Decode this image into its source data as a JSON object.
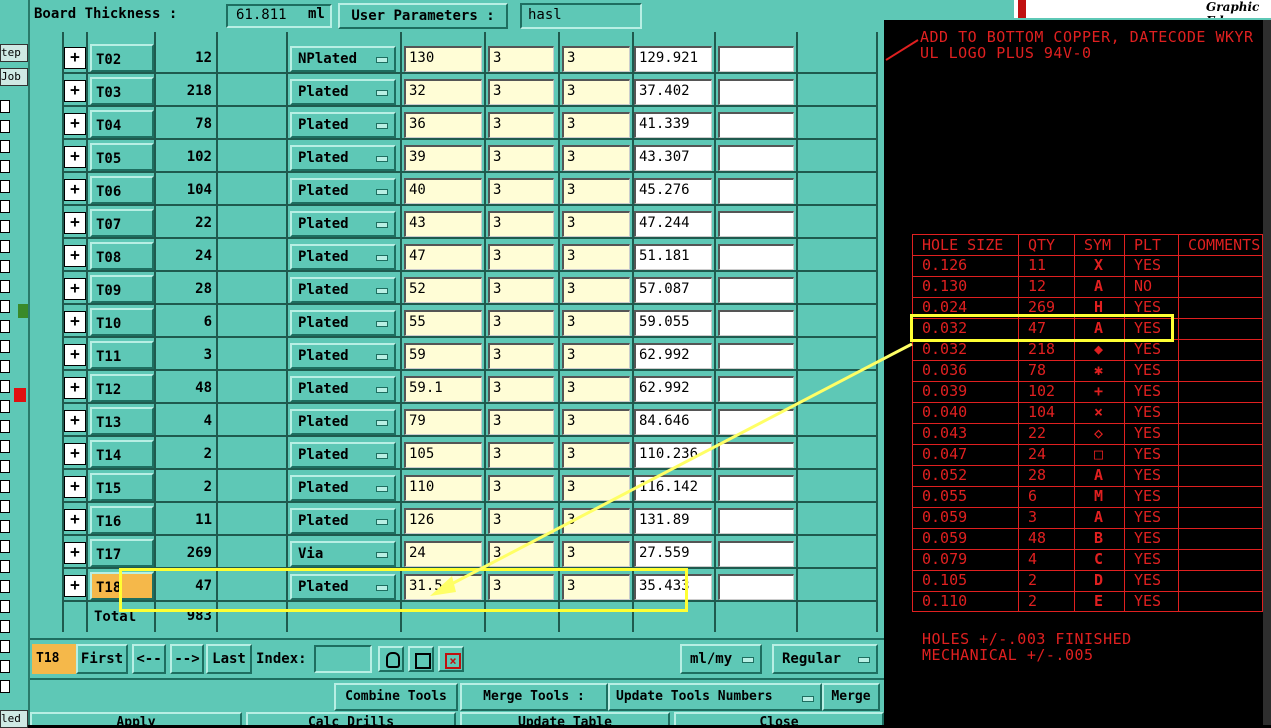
{
  "header": {
    "board_thickness_label": "Board Thickness :",
    "board_thickness_value": "61.811",
    "board_thickness_unit": "ml",
    "user_params_label": "User Parameters :",
    "user_params_value": "hasl"
  },
  "leftstrip": {
    "step_label": "tep",
    "job_label": "Job",
    "bottom_label": "led"
  },
  "tools": [
    {
      "id": "T02",
      "qty": "12",
      "type": "NPlated",
      "size": "130",
      "a": "3",
      "b": "3",
      "fin": "129.921"
    },
    {
      "id": "T03",
      "qty": "218",
      "type": "Plated",
      "size": "32",
      "a": "3",
      "b": "3",
      "fin": "37.402"
    },
    {
      "id": "T04",
      "qty": "78",
      "type": "Plated",
      "size": "36",
      "a": "3",
      "b": "3",
      "fin": "41.339"
    },
    {
      "id": "T05",
      "qty": "102",
      "type": "Plated",
      "size": "39",
      "a": "3",
      "b": "3",
      "fin": "43.307"
    },
    {
      "id": "T06",
      "qty": "104",
      "type": "Plated",
      "size": "40",
      "a": "3",
      "b": "3",
      "fin": "45.276"
    },
    {
      "id": "T07",
      "qty": "22",
      "type": "Plated",
      "size": "43",
      "a": "3",
      "b": "3",
      "fin": "47.244"
    },
    {
      "id": "T08",
      "qty": "24",
      "type": "Plated",
      "size": "47",
      "a": "3",
      "b": "3",
      "fin": "51.181"
    },
    {
      "id": "T09",
      "qty": "28",
      "type": "Plated",
      "size": "52",
      "a": "3",
      "b": "3",
      "fin": "57.087"
    },
    {
      "id": "T10",
      "qty": "6",
      "type": "Plated",
      "size": "55",
      "a": "3",
      "b": "3",
      "fin": "59.055"
    },
    {
      "id": "T11",
      "qty": "3",
      "type": "Plated",
      "size": "59",
      "a": "3",
      "b": "3",
      "fin": "62.992"
    },
    {
      "id": "T12",
      "qty": "48",
      "type": "Plated",
      "size": "59.1",
      "a": "3",
      "b": "3",
      "fin": "62.992"
    },
    {
      "id": "T13",
      "qty": "4",
      "type": "Plated",
      "size": "79",
      "a": "3",
      "b": "3",
      "fin": "84.646"
    },
    {
      "id": "T14",
      "qty": "2",
      "type": "Plated",
      "size": "105",
      "a": "3",
      "b": "3",
      "fin": "110.236"
    },
    {
      "id": "T15",
      "qty": "2",
      "type": "Plated",
      "size": "110",
      "a": "3",
      "b": "3",
      "fin": "116.142"
    },
    {
      "id": "T16",
      "qty": "11",
      "type": "Plated",
      "size": "126",
      "a": "3",
      "b": "3",
      "fin": "131.89"
    },
    {
      "id": "T17",
      "qty": "269",
      "type": "Via",
      "size": "24",
      "a": "3",
      "b": "3",
      "fin": "27.559"
    },
    {
      "id": "T18",
      "qty": "47",
      "type": "Plated",
      "size": "31.5",
      "a": "3",
      "b": "3",
      "fin": "35.433"
    }
  ],
  "total": {
    "label": "Total",
    "value": "983"
  },
  "nav": {
    "current_tool": "T18",
    "first": "First",
    "prev": "<--",
    "next": "-->",
    "last": "Last",
    "index_label": "Index:",
    "units": "ml/my",
    "mode": "Regular"
  },
  "actions": {
    "combine": "Combine Tools",
    "merge_tools": "Merge Tools :",
    "update_numbers": "Update Tools Numbers",
    "merge": "Merge"
  },
  "bottom_buttons": [
    "Apply",
    "Calc Drills",
    "Update Table",
    "Close"
  ],
  "right_panel": {
    "brand": "Graphic Ed",
    "note_line1": "ADD TO BOTTOM COPPER, DATECODE WKYR",
    "note_line2": "UL LOGO PLUS 94V-0",
    "headers": [
      "HOLE SIZE",
      "QTY",
      "SYM",
      "PLT",
      "COMMENTS"
    ],
    "rows": [
      {
        "size": "0.126",
        "qty": "11",
        "sym": "X",
        "plt": "YES"
      },
      {
        "size": "0.130",
        "qty": "12",
        "sym": "A",
        "plt": "NO"
      },
      {
        "size": "0.024",
        "qty": "269",
        "sym": "H",
        "plt": "YES"
      },
      {
        "size": "0.032",
        "qty": "47",
        "sym": "A",
        "plt": "YES"
      },
      {
        "size": "0.032",
        "qty": "218",
        "sym": "◆",
        "plt": "YES"
      },
      {
        "size": "0.036",
        "qty": "78",
        "sym": "✱",
        "plt": "YES"
      },
      {
        "size": "0.039",
        "qty": "102",
        "sym": "+",
        "plt": "YES"
      },
      {
        "size": "0.040",
        "qty": "104",
        "sym": "×",
        "plt": "YES"
      },
      {
        "size": "0.043",
        "qty": "22",
        "sym": "◇",
        "plt": "YES"
      },
      {
        "size": "0.047",
        "qty": "24",
        "sym": "□",
        "plt": "YES"
      },
      {
        "size": "0.052",
        "qty": "28",
        "sym": "A",
        "plt": "YES"
      },
      {
        "size": "0.055",
        "qty": "6",
        "sym": "M",
        "plt": "YES"
      },
      {
        "size": "0.059",
        "qty": "3",
        "sym": "A",
        "plt": "YES"
      },
      {
        "size": "0.059",
        "qty": "48",
        "sym": "B",
        "plt": "YES"
      },
      {
        "size": "0.079",
        "qty": "4",
        "sym": "C",
        "plt": "YES"
      },
      {
        "size": "0.105",
        "qty": "2",
        "sym": "D",
        "plt": "YES"
      },
      {
        "size": "0.110",
        "qty": "2",
        "sym": "E",
        "plt": "YES"
      }
    ],
    "footer_line1": "HOLES +/-.003 FINISHED",
    "footer_line2": "MECHANICAL +/-.005"
  },
  "colors": {
    "teal": "#5ec8b6",
    "cream": "#fffdd6",
    "red": "#e02020",
    "highlight": "#ffff33",
    "orange": "#f5b84a"
  }
}
